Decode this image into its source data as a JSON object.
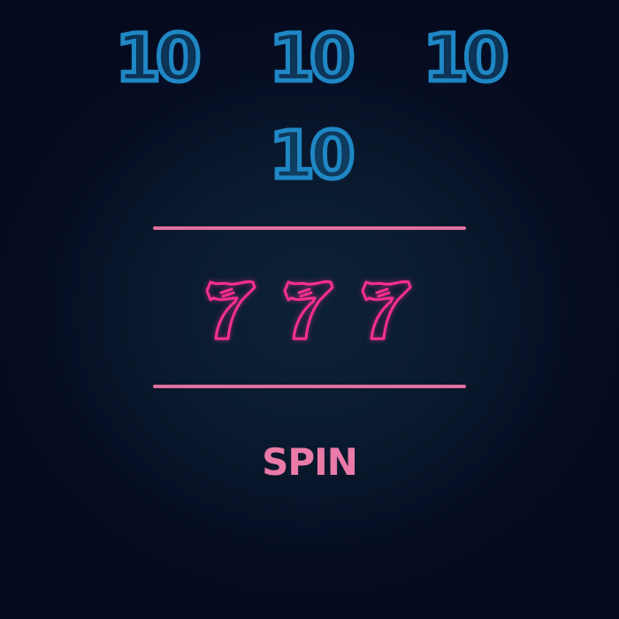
{
  "scores": [
    "10",
    "10",
    "10",
    "10"
  ],
  "reels": [
    {
      "symbol": "seven-icon"
    },
    {
      "symbol": "seven-icon"
    },
    {
      "symbol": "seven-icon"
    }
  ],
  "spin_label": "SPIN",
  "colors": {
    "score_outline": "#1f87c4",
    "divider": "#e0709e",
    "reel_symbol": "#ff2f92",
    "spin_text": "#ea7aa8",
    "background": "#070d24"
  }
}
